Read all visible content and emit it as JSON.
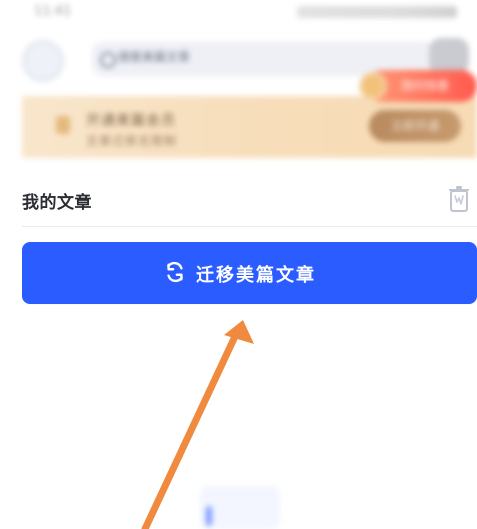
{
  "status_bar": {
    "time": "11:41"
  },
  "header": {
    "search_placeholder": "搜索美篇文章"
  },
  "promo_banner": {
    "title": "开通美篇会员",
    "subtitle": "文章迁移无限制",
    "cta_label": "立即开通",
    "chip_label": "限时特惠",
    "colors": {
      "banner_bg": "#F7DDB9",
      "cta_bg": "#C79A6E",
      "chip_bg": "#FF6D5A"
    }
  },
  "section": {
    "title": "我的文章",
    "trash_icon": "trash-icon"
  },
  "primary_action": {
    "label": "迁移美篇文章",
    "icon": "refresh-icon",
    "color": "#2B5CFF"
  },
  "annotation": {
    "arrow_color": "#F08A3E"
  }
}
